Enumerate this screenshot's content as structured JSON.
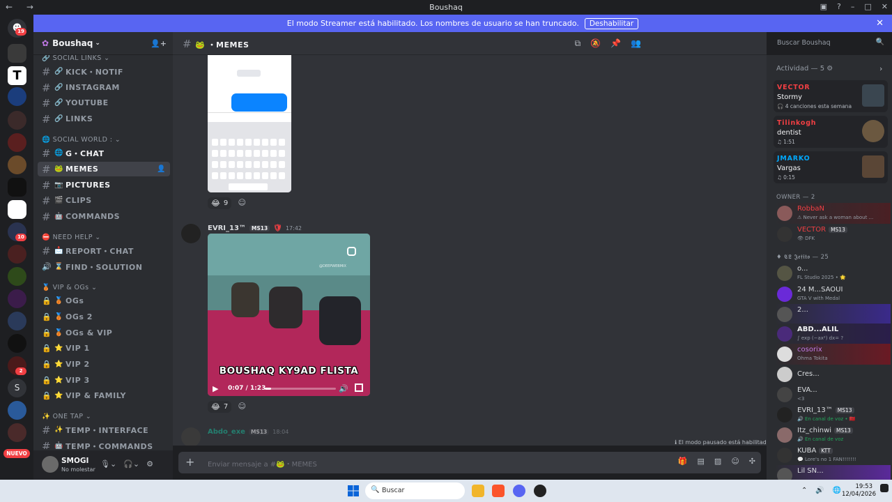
{
  "window": {
    "title": "Boushaq",
    "controls": [
      "▣",
      "?",
      "–",
      "□",
      "✕"
    ]
  },
  "banner": {
    "text": "El modo Streamer está habilitado. Los nombres de usuario se han truncado.",
    "button": "Deshabilitar"
  },
  "guild_badges": {
    "top": "19",
    "mid": "10",
    "low": "2",
    "nuevo": "NUEVO",
    "s_letter": "S"
  },
  "server": {
    "name": "Boushaq"
  },
  "categories": {
    "social_links": "SOCIAL LINKS",
    "social_world": "SOCIAL WORLD :",
    "need_help": "NEED HELP",
    "vip_ogs": "VIP & OGs",
    "one_tap": "ONE TAP"
  },
  "channels": [
    {
      "label": "KICK・NOTIF",
      "emoji": "🔗",
      "kind": "#"
    },
    {
      "label": "INSTAGRAM",
      "emoji": "🔗",
      "kind": "#"
    },
    {
      "label": "YOUTUBE",
      "emoji": "🔗",
      "kind": "#"
    },
    {
      "label": "LINKS",
      "emoji": "🔗",
      "kind": "#"
    },
    {
      "label": "G・CHAT",
      "emoji": "🌐",
      "kind": "#"
    },
    {
      "label": "MEMES",
      "emoji": "🐸",
      "kind": "#"
    },
    {
      "label": "PICTURES",
      "emoji": "📷",
      "kind": "#"
    },
    {
      "label": "CLIPS",
      "emoji": "🎬",
      "kind": "#"
    },
    {
      "label": "COMMANDS",
      "emoji": "🤖",
      "kind": "#"
    },
    {
      "label": "REPORT・CHAT",
      "emoji": "📩",
      "kind": "#"
    },
    {
      "label": "FIND・SOLUTION",
      "emoji": "⌛",
      "kind": "🔊"
    },
    {
      "label": "OGs",
      "emoji": "🥉",
      "kind": "🔒"
    },
    {
      "label": "OGs 2",
      "emoji": "🥉",
      "kind": "🔒"
    },
    {
      "label": "OGs & VIP",
      "emoji": "🥉",
      "kind": "🔒"
    },
    {
      "label": "VIP 1",
      "emoji": "⭐",
      "kind": "🔒"
    },
    {
      "label": "VIP 2",
      "emoji": "⭐",
      "kind": "🔒"
    },
    {
      "label": "VIP 3",
      "emoji": "⭐",
      "kind": "🔒"
    },
    {
      "label": "VIP & FAMILY",
      "emoji": "⭐",
      "kind": "🔒"
    },
    {
      "label": "TEMP・INTERFACE",
      "emoji": "✨",
      "kind": "#"
    },
    {
      "label": "TEMP・COMMANDS",
      "emoji": "🤖",
      "kind": "#"
    }
  ],
  "user": {
    "name": "SMOGI",
    "status": "No molestar"
  },
  "chat_header": {
    "channel": "・MEMES"
  },
  "search": {
    "placeholder": "Buscar Boushaq"
  },
  "messages": {
    "first_reaction_count": "9",
    "second": {
      "author": "EVRI_13™",
      "tag": "MS13",
      "time": "17:42",
      "video_caption": "BOUSHAQ KY9AD FLISTA",
      "watermark": "@DEEPWEBMIX",
      "video_time": "0:07 / 1:23",
      "progress": 0.09,
      "reaction_count": "7"
    },
    "third": {
      "author": "Abdo_exe",
      "tag": "MS13",
      "time": "18:04"
    }
  },
  "pause_info": "El modo pausado está habilitado.",
  "composer": {
    "placeholder": "Enviar mensaje a #🐸・MEMES"
  },
  "activity": {
    "header": "Actividad — 5",
    "cards": [
      {
        "name": "VECTOR",
        "color": "#f23f43",
        "title": "Stormy",
        "sub": "4 canciones esta semana"
      },
      {
        "name": "Tilinkogh",
        "color": "#f23f43",
        "title": "dentist",
        "sub": "1:51"
      },
      {
        "name": "JMARKO",
        "color": "#00a8fc",
        "title": "Vargas",
        "sub": "0:15"
      }
    ]
  },
  "member_groups": {
    "owner": "OWNER — 2",
    "jefito": "𝕮𝕷 𝕵𝖊𝖋𝖎𝖙𝖔 — 25"
  },
  "members": [
    {
      "name": "RobbaN",
      "color": "#f23f43",
      "status": "Never ask a woman about ..."
    },
    {
      "name": "VECTOR",
      "color": "#f23f43",
      "tag": "MS13",
      "status": "DFK"
    },
    {
      "name": "o...",
      "color": "#dbdee1",
      "status": "FL Studio 2025 • 🌟"
    },
    {
      "name": "24 M...SAOUI",
      "color": "#dbdee1",
      "status": "GTA V with Medal"
    },
    {
      "name": "2...",
      "color": "#dbdee1",
      "status": ""
    },
    {
      "name": "ABD...ALIL",
      "color": "#dbdee1",
      "status": "∫ exp (−ax²) dx= ?"
    },
    {
      "name": "cosorix",
      "color": "#c27ae8",
      "status": "Ohma Tokita"
    },
    {
      "name": "Cres...",
      "color": "#dbdee1",
      "status": ""
    },
    {
      "name": "EVA...",
      "color": "#dbdee1",
      "status": "<3"
    },
    {
      "name": "EVRI_13™",
      "color": "#dbdee1",
      "tag": "MS13",
      "status": "En canal de voz • 🇲🇦"
    },
    {
      "name": "Itz_chinwi",
      "color": "#dbdee1",
      "tag": "MS13",
      "status": "En canal de voz"
    },
    {
      "name": "KUBA",
      "color": "#dbdee1",
      "tag": "KTT",
      "status": "Lore's no 1 FAN!!!!!!!"
    },
    {
      "name": "Lil SN...",
      "color": "#dbdee1",
      "status": ""
    }
  ],
  "taskbar": {
    "search": "Buscar",
    "time": "19:53",
    "date": "12/04/2026"
  }
}
